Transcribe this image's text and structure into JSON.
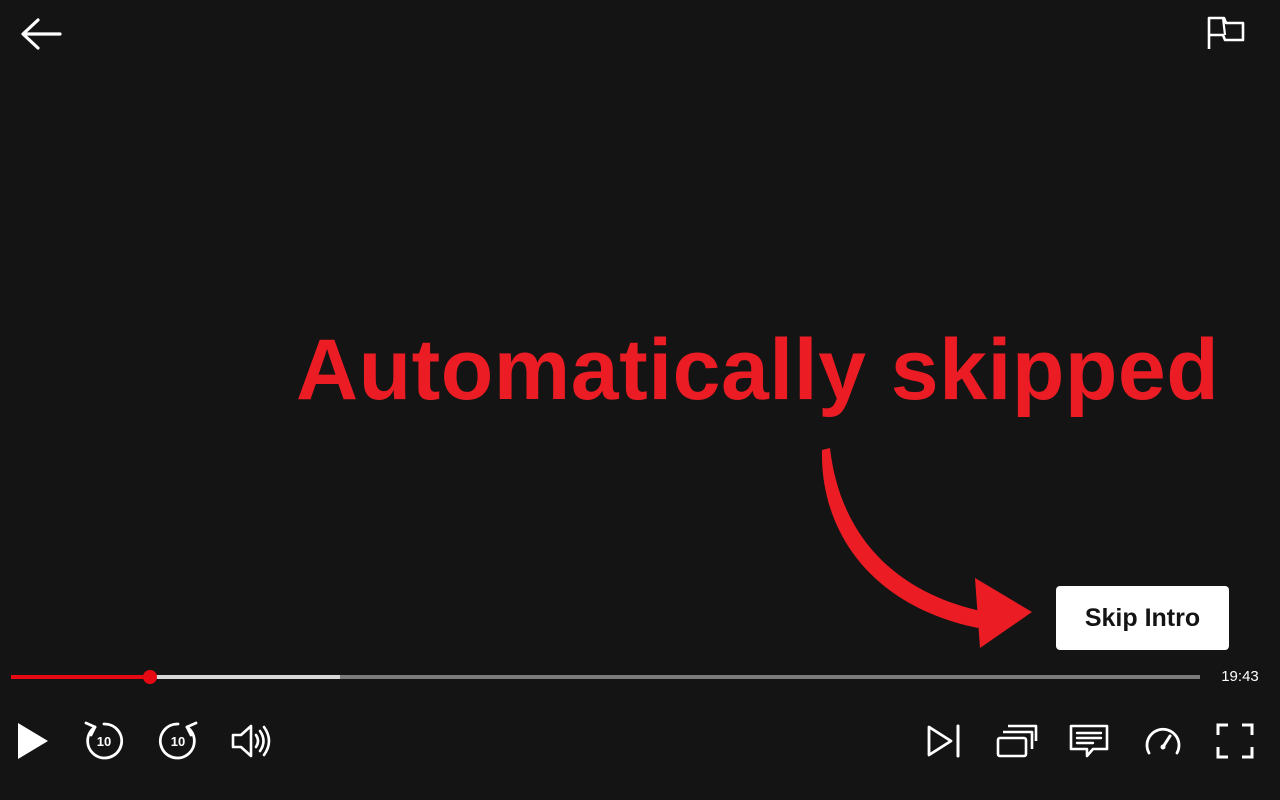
{
  "player": {
    "annotation_text": "Automatically skipped",
    "skip_intro_label": "Skip Intro",
    "time_remaining": "19:43",
    "progress": {
      "played_fraction": 0.117,
      "buffered_fraction": 0.277
    },
    "rewind_seconds": "10",
    "forward_seconds": "10"
  },
  "icons": {
    "back": "arrow-left-icon",
    "report": "flag-icon",
    "play": "play-icon",
    "rewind": "rewind-10-icon",
    "forward": "forward-10-icon",
    "volume": "volume-icon",
    "next": "next-episode-icon",
    "episodes": "episodes-icon",
    "subtitles": "subtitles-icon",
    "speed": "speedometer-icon",
    "fullscreen": "fullscreen-icon"
  },
  "colors": {
    "background": "#141414",
    "accent": "#e50914",
    "annotation": "#ec1c24",
    "buffered": "#d8d8d8",
    "track": "#7b7b7b"
  }
}
